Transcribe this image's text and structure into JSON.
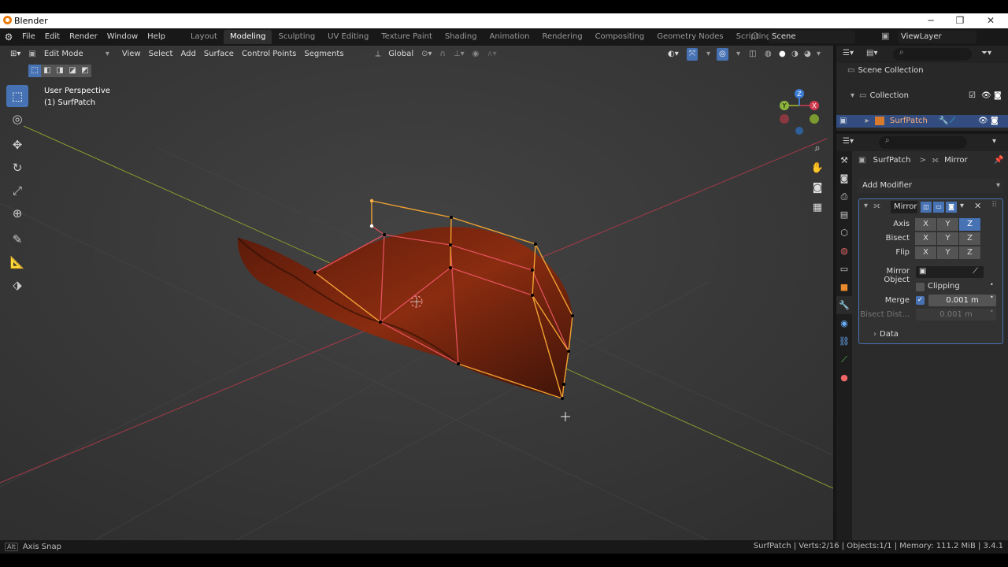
{
  "window": {
    "title": "Blender",
    "min": "─",
    "max": "❐",
    "close": "✕"
  },
  "menubar": {
    "menus": [
      "File",
      "Edit",
      "Render",
      "Window",
      "Help"
    ],
    "workspaces": [
      "Layout",
      "Modeling",
      "Sculpting",
      "UV Editing",
      "Texture Paint",
      "Shading",
      "Animation",
      "Rendering",
      "Compositing",
      "Geometry Nodes",
      "Scripting"
    ],
    "active_workspace": "Modeling",
    "add_workspace": "+",
    "scene": "Scene",
    "view_layer": "ViewLayer"
  },
  "viewport_header": {
    "mode": "Edit Mode",
    "menus": [
      "View",
      "Select",
      "Add",
      "Surface",
      "Control Points",
      "Segments"
    ],
    "transform_orientation": "Global"
  },
  "viewport": {
    "perspective": "User Perspective",
    "object_label": "(1) SurfPatch",
    "gizmo": {
      "x": "X",
      "y": "Y",
      "z": "Z"
    }
  },
  "outliner": {
    "scene_collection": "Scene Collection",
    "collection": "Collection",
    "object": "SurfPatch"
  },
  "properties": {
    "breadcrumb_object": "SurfPatch",
    "breadcrumb_sep": ">",
    "breadcrumb_modifier": "Mirror",
    "add_modifier": "Add Modifier",
    "modifier": {
      "name": "Mirror",
      "axis_label": "Axis",
      "bisect_label": "Bisect",
      "flip_label": "Flip",
      "axis_letters": [
        "X",
        "Y",
        "Z"
      ],
      "mirror_object_label": "Mirror Object",
      "clipping_label": "Clipping",
      "merge_label": "Merge",
      "merge_value": "0.001 m",
      "bisect_distance_label": "Bisect Dist...",
      "bisect_distance_value": "0.001 m",
      "data_label": "Data",
      "axis_enabled": [
        false,
        false,
        true
      ]
    }
  },
  "statusbar": {
    "key": "Alt",
    "hint": "Axis Snap",
    "stats": "SurfPatch | Verts:2/16 | Objects:1/1 | Memory: 111.2 MiB | 3.4.1"
  },
  "colors": {
    "accent": "#4772b3",
    "x_axis": "#a73a48",
    "y_axis": "#8a9a2e",
    "wire": "#f0a030",
    "wire_inner": "#e2505c",
    "surface": "#8a2c10"
  }
}
